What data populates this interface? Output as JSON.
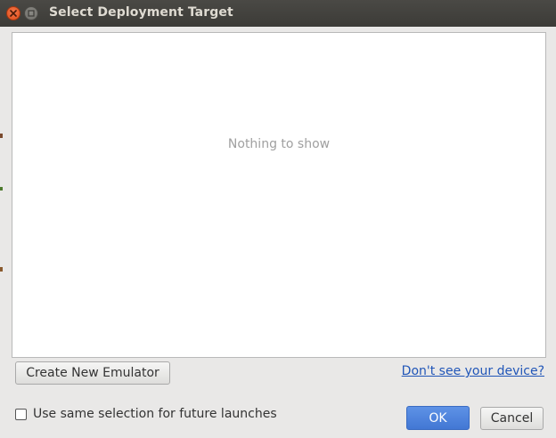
{
  "window": {
    "title": "Select Deployment Target"
  },
  "device_list": {
    "empty_text": "Nothing to show"
  },
  "actions": {
    "create_emulator_label": "Create New Emulator",
    "device_help_link": "Don't see your device?"
  },
  "options": {
    "same_selection_label": "Use same selection for future launches",
    "same_selection_checked": false
  },
  "footer": {
    "ok_label": "OK",
    "cancel_label": "Cancel"
  },
  "colors": {
    "titlebar": "#3c3b37",
    "close_button": "#df4a16",
    "ok_button": "#4a7fd8",
    "link": "#2156b8"
  }
}
